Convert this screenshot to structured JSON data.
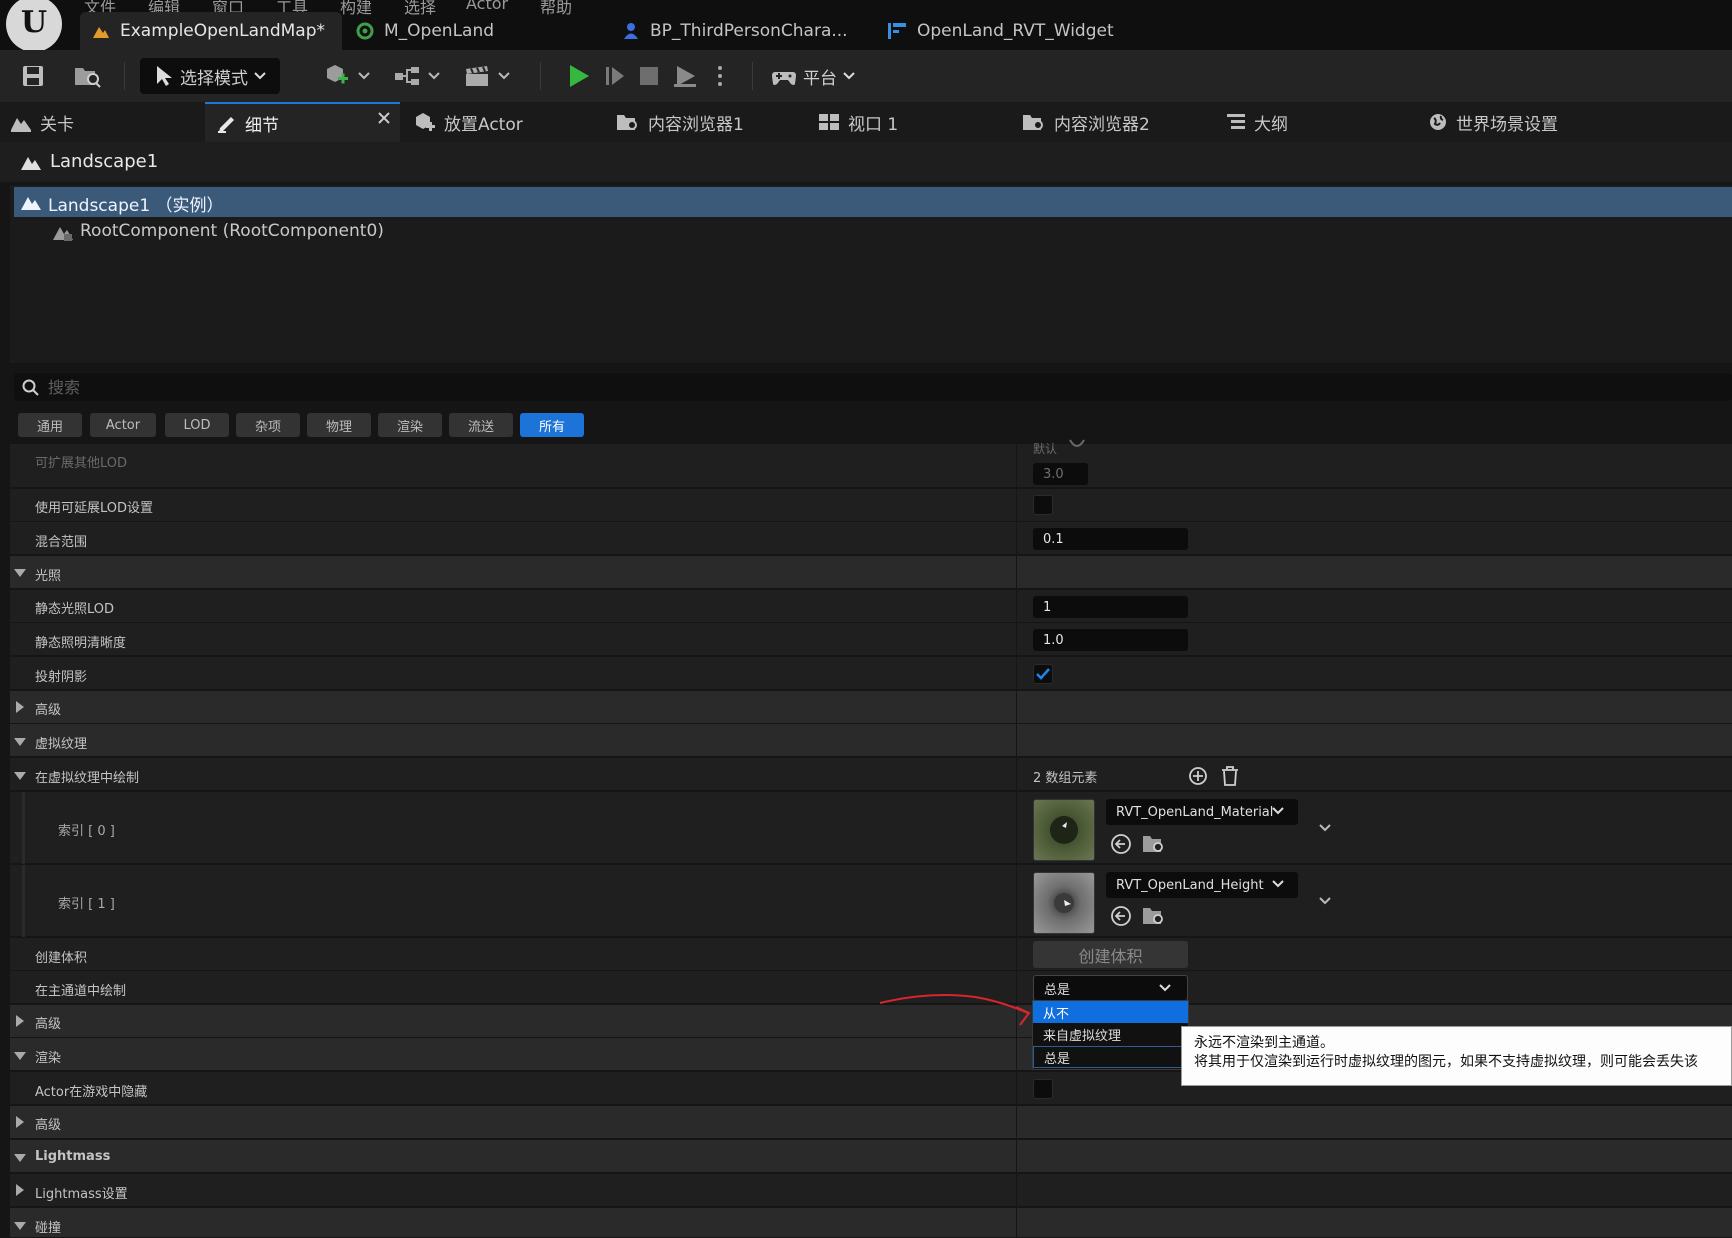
{
  "menu": [
    "文件",
    "编辑",
    "窗口",
    "工具",
    "构建",
    "选择",
    "Actor",
    "帮助"
  ],
  "doc_tabs": [
    {
      "label": "ExampleOpenLandMap*",
      "icon": "level-icon"
    },
    {
      "label": "M_OpenLand",
      "icon": "material-icon"
    },
    {
      "label": "BP_ThirdPersonChara...",
      "icon": "blueprint-icon"
    },
    {
      "label": "OpenLand_RVT_Widget",
      "icon": "widget-icon"
    }
  ],
  "toolbar": {
    "mode_label": "选择模式",
    "platform_label": "平台"
  },
  "panel_tabs": [
    {
      "label": "关卡"
    },
    {
      "label": "细节"
    },
    {
      "label": "放置Actor"
    },
    {
      "label": "内容浏览器1"
    },
    {
      "label": "视口 1"
    },
    {
      "label": "内容浏览器2"
    },
    {
      "label": "大纲"
    },
    {
      "label": "世界场景设置"
    }
  ],
  "details": {
    "actor_name": "Landscape1",
    "components": [
      "Landscape1 （实例）",
      "RootComponent (RootComponent0)"
    ],
    "search_placeholder": "搜索",
    "filters": [
      "通用",
      "Actor",
      "LOD",
      "杂项",
      "物理",
      "渲染",
      "流送",
      "所有"
    ],
    "active_filter": "所有"
  },
  "properties": {
    "extended_lod": {
      "label": "可扩展其他LOD",
      "top_value": "默认",
      "value": "3.0"
    },
    "use_lod_settings": {
      "label": "使用可延展LOD设置"
    },
    "blend_range": {
      "label": "混合范围",
      "value": "0.1"
    },
    "lighting": {
      "label": "光照"
    },
    "static_lighting_lod": {
      "label": "静态光照LOD",
      "value": "1"
    },
    "static_lighting_resolution": {
      "label": "静态照明清晰度",
      "value": "1.0"
    },
    "cast_shadow": {
      "label": "投射阴影",
      "checked": true
    },
    "advanced_1": {
      "label": "高级"
    },
    "virtual_texture": {
      "label": "虚拟纹理"
    },
    "draw_in_vt": {
      "label": "在虚拟纹理中绘制",
      "count": "2 数组元素"
    },
    "index_0": {
      "label": "索引 [ 0 ]",
      "asset": "RVT_OpenLand_Material"
    },
    "index_1": {
      "label": "索引 [ 1 ]",
      "asset": "RVT_OpenLand_Height"
    },
    "create_volume": {
      "label": "创建体积",
      "button": "创建体积"
    },
    "draw_in_main_pass": {
      "label": "在主通道中绘制",
      "value": "总是",
      "options": [
        "从不",
        "来自虚拟纹理",
        "总是"
      ]
    },
    "advanced_2": {
      "label": "高级"
    },
    "rendering": {
      "label": "渲染"
    },
    "actor_hidden": {
      "label": "Actor在游戏中隐藏"
    },
    "advanced_3": {
      "label": "高级"
    },
    "lightmass": {
      "label": "Lightmass"
    },
    "lightmass_settings": {
      "label": "Lightmass设置"
    },
    "collision": {
      "label": "碰撞"
    }
  },
  "tooltip": {
    "line1": "永远不渲染到主通道。",
    "line2": "将其用于仅渲染到运行时虚拟纹理的图元，如果不支持虚拟纹理，则可能会丢失该"
  },
  "colors": {
    "accent": "#1d74d8",
    "selection": "#3b5a7a",
    "annotation": "#d8262c"
  }
}
